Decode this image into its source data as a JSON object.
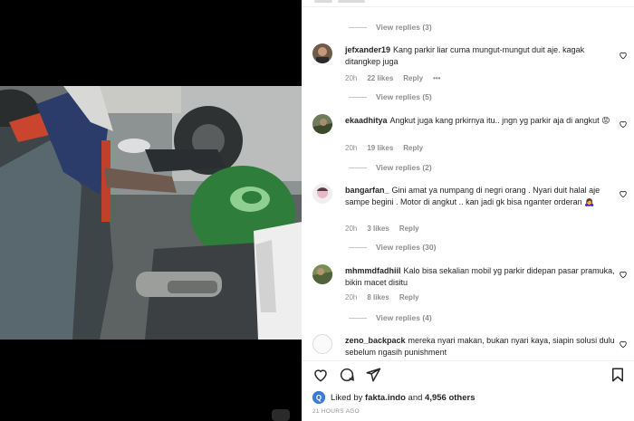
{
  "comments_top": {
    "view_replies": "View replies (3)"
  },
  "comments": [
    {
      "username": "jefxander19",
      "text": "Kang parkir liar cuma mungut-mungut duit aje. kagak ditangkep juga",
      "time": "20h",
      "likes": "22 likes",
      "reply": "Reply",
      "more": "•••",
      "view_replies": "View replies (5)"
    },
    {
      "username": "ekaadhitya",
      "text": "Angkut juga kang prkirnya itu.. jngn yg parkir aja di angkut 😡",
      "time": "20h",
      "likes": "19 likes",
      "reply": "Reply",
      "view_replies": "View replies (2)"
    },
    {
      "username": "bangarfan_",
      "text": "Gini amat ya numpang di negri orang . Nyari duit halal aje sampe begini . Motor di angkut .. kan jadi gk bisa nganter orderan 🙇‍♀️",
      "time": "20h",
      "likes": "3 likes",
      "reply": "Reply",
      "view_replies": "View replies (30)"
    },
    {
      "username": "mhmmdfadhiil",
      "text": "Kalo bisa sekalian mobil yg parkir didepan pasar pramuka, bikin macet disitu",
      "time": "20h",
      "likes": "8 likes",
      "reply": "Reply",
      "view_replies": "View replies (4)"
    },
    {
      "username": "zeno_backpack",
      "text": "mereka nyari makan, bukan nyari kaya, siapin solusi dulu sebelum ngasih punishment"
    }
  ],
  "footer": {
    "liked_prefix": "Liked by",
    "liked_user": "fakta.indo",
    "liked_and": "and",
    "liked_others": "4,956 others",
    "time_ago": "21 HOURS AGO"
  },
  "icons": {
    "like": "heart-icon",
    "comment": "comment-icon",
    "share": "share-icon",
    "save": "bookmark-icon"
  },
  "colors": {
    "text": "#262626",
    "muted": "#8e8e8e",
    "background": "#ffffff",
    "video_bg": "#000000"
  }
}
